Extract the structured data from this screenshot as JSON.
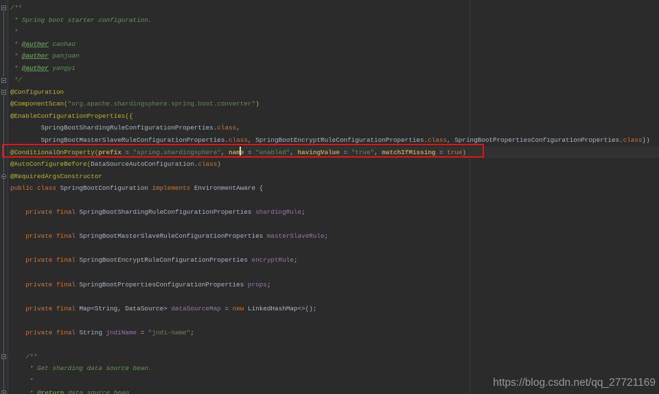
{
  "editor": {
    "colors": {
      "background": "#2b2b2b",
      "annotation": "#bbb529",
      "string": "#6a8759",
      "keyword": "#cc7832",
      "field": "#9876aa",
      "comment": "#629755",
      "default_text": "#a9b7c6",
      "attribute_name": "#bfa054",
      "red_box": "#e31414",
      "guide_line": "#3a3d3f"
    },
    "lines": [
      {
        "tokens": [
          {
            "t": "/**",
            "c": "cm"
          }
        ]
      },
      {
        "tokens": [
          {
            "t": " * Spring boot starter configuration.",
            "c": "cm"
          }
        ]
      },
      {
        "tokens": [
          {
            "t": " *",
            "c": "cm"
          }
        ]
      },
      {
        "tokens": [
          {
            "t": " * ",
            "c": "cm"
          },
          {
            "t": "@author",
            "c": "cmt"
          },
          {
            "t": " caohao",
            "c": "cm"
          }
        ]
      },
      {
        "tokens": [
          {
            "t": " * ",
            "c": "cm"
          },
          {
            "t": "@author",
            "c": "cmt"
          },
          {
            "t": " panjuan",
            "c": "cm"
          }
        ]
      },
      {
        "tokens": [
          {
            "t": " * ",
            "c": "cm"
          },
          {
            "t": "@author",
            "c": "cmt"
          },
          {
            "t": " yangyi",
            "c": "cm"
          }
        ]
      },
      {
        "tokens": [
          {
            "t": " */",
            "c": "cm"
          }
        ]
      },
      {
        "tokens": [
          {
            "t": "@Configuration",
            "c": "an"
          }
        ]
      },
      {
        "tokens": [
          {
            "t": "@ComponentScan(",
            "c": "an"
          },
          {
            "t": "\"org.apache.shardingsphere.spring.boot.converter\"",
            "c": "str"
          },
          {
            "t": ")",
            "c": "an"
          }
        ]
      },
      {
        "tokens": [
          {
            "t": "@EnableConfigurationProperties({",
            "c": "an"
          }
        ]
      },
      {
        "tokens": [
          {
            "t": "        SpringBootShardingRuleConfigurationProperties.",
            "c": "df"
          },
          {
            "t": "class",
            "c": "kw"
          },
          {
            "t": ",",
            "c": "df"
          }
        ]
      },
      {
        "tokens": [
          {
            "t": "        SpringBootMasterSlaveRuleConfigurationProperties.",
            "c": "df"
          },
          {
            "t": "class",
            "c": "kw"
          },
          {
            "t": ", SpringBootEncryptRuleConfigurationProperties.",
            "c": "df"
          },
          {
            "t": "class",
            "c": "kw"
          },
          {
            "t": ", SpringBootPropertiesConfigurationProperties.",
            "c": "df"
          },
          {
            "t": "class",
            "c": "kw"
          },
          {
            "t": "})",
            "c": "df"
          }
        ]
      },
      {
        "hl": true,
        "tokens": [
          {
            "t": "@ConditionalOnProperty(",
            "c": "an"
          },
          {
            "t": "prefix",
            "c": "attr"
          },
          {
            "t": " = ",
            "c": "df"
          },
          {
            "t": "\"spring.shardingsphere\"",
            "c": "str"
          },
          {
            "t": ", ",
            "c": "df"
          },
          {
            "t": "nam",
            "c": "attr"
          },
          {
            "t": "",
            "c": "caret"
          },
          {
            "t": "e",
            "c": "attr"
          },
          {
            "t": " = ",
            "c": "df"
          },
          {
            "t": "\"enabled\"",
            "c": "str"
          },
          {
            "t": ", ",
            "c": "df"
          },
          {
            "t": "havingValue",
            "c": "attr"
          },
          {
            "t": " = ",
            "c": "df"
          },
          {
            "t": "\"true\"",
            "c": "str"
          },
          {
            "t": ", ",
            "c": "df"
          },
          {
            "t": "matchIfMissing",
            "c": "attr"
          },
          {
            "t": " = ",
            "c": "df"
          },
          {
            "t": "true",
            "c": "kw"
          },
          {
            "t": ")",
            "c": "an"
          }
        ]
      },
      {
        "tokens": [
          {
            "t": "@AutoConfigureBefore(",
            "c": "an"
          },
          {
            "t": "DataSourceAutoConfiguration.",
            "c": "df"
          },
          {
            "t": "class",
            "c": "kw"
          },
          {
            "t": ")",
            "c": "an"
          }
        ]
      },
      {
        "tokens": [
          {
            "t": "@RequiredArgsConstructor",
            "c": "an"
          }
        ]
      },
      {
        "tokens": [
          {
            "t": "public class ",
            "c": "kw"
          },
          {
            "t": "SpringBootConfiguration ",
            "c": "df"
          },
          {
            "t": "implements ",
            "c": "kw"
          },
          {
            "t": "EnvironmentAware {",
            "c": "df"
          }
        ]
      },
      {
        "tokens": []
      },
      {
        "tokens": [
          {
            "t": "    ",
            "c": "df"
          },
          {
            "t": "private final ",
            "c": "kw"
          },
          {
            "t": "SpringBootShardingRuleConfigurationProperties ",
            "c": "df"
          },
          {
            "t": "shardingRule",
            "c": "fld"
          },
          {
            "t": ";",
            "c": "df"
          }
        ]
      },
      {
        "tokens": []
      },
      {
        "tokens": [
          {
            "t": "    ",
            "c": "df"
          },
          {
            "t": "private final ",
            "c": "kw"
          },
          {
            "t": "SpringBootMasterSlaveRuleConfigurationProperties ",
            "c": "df"
          },
          {
            "t": "masterSlaveRule",
            "c": "fld"
          },
          {
            "t": ";",
            "c": "df"
          }
        ]
      },
      {
        "tokens": []
      },
      {
        "tokens": [
          {
            "t": "    ",
            "c": "df"
          },
          {
            "t": "private final ",
            "c": "kw"
          },
          {
            "t": "SpringBootEncryptRuleConfigurationProperties ",
            "c": "df"
          },
          {
            "t": "encryptRule",
            "c": "fld"
          },
          {
            "t": ";",
            "c": "df"
          }
        ]
      },
      {
        "tokens": []
      },
      {
        "tokens": [
          {
            "t": "    ",
            "c": "df"
          },
          {
            "t": "private final ",
            "c": "kw"
          },
          {
            "t": "SpringBootPropertiesConfigurationProperties ",
            "c": "df"
          },
          {
            "t": "props",
            "c": "fld"
          },
          {
            "t": ";",
            "c": "df"
          }
        ]
      },
      {
        "tokens": []
      },
      {
        "tokens": [
          {
            "t": "    ",
            "c": "df"
          },
          {
            "t": "private final ",
            "c": "kw"
          },
          {
            "t": "Map<String, DataSource> ",
            "c": "df"
          },
          {
            "t": "dataSourceMap",
            "c": "fld"
          },
          {
            "t": " = ",
            "c": "df"
          },
          {
            "t": "new ",
            "c": "kw"
          },
          {
            "t": "LinkedHashMap<>();",
            "c": "df"
          }
        ]
      },
      {
        "tokens": []
      },
      {
        "tokens": [
          {
            "t": "    ",
            "c": "df"
          },
          {
            "t": "private final ",
            "c": "kw"
          },
          {
            "t": "String ",
            "c": "df"
          },
          {
            "t": "jndiName",
            "c": "fld"
          },
          {
            "t": " = ",
            "c": "df"
          },
          {
            "t": "\"jndi-name\"",
            "c": "str"
          },
          {
            "t": ";",
            "c": "df"
          }
        ]
      },
      {
        "tokens": []
      },
      {
        "tokens": [
          {
            "t": "    /**",
            "c": "cm"
          }
        ]
      },
      {
        "tokens": [
          {
            "t": "     * Get sharding data source bean.",
            "c": "cm"
          }
        ]
      },
      {
        "tokens": [
          {
            "t": "     *",
            "c": "cm"
          }
        ]
      },
      {
        "tokens": [
          {
            "t": "     * ",
            "c": "cm"
          },
          {
            "t": "@return",
            "c": "cmt"
          },
          {
            "t": " data source bean",
            "c": "cm"
          }
        ]
      }
    ]
  },
  "gutter": {
    "markers": [
      {
        "shape": "box",
        "line": 0
      },
      {
        "shape": "box",
        "line": 6
      },
      {
        "shape": "box",
        "line": 7
      },
      {
        "shape": "circle",
        "line": 14
      },
      {
        "shape": "box",
        "line": 29
      },
      {
        "shape": "box",
        "line": 32
      }
    ]
  },
  "watermark": {
    "text": "https://blog.csdn.net/qq_27721169"
  }
}
